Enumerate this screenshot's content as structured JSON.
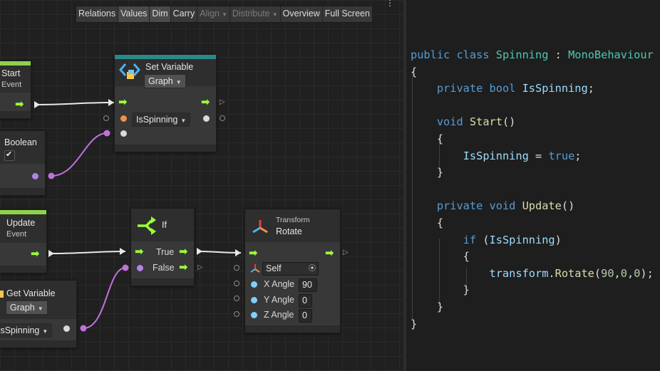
{
  "toolbar": {
    "buttons": [
      {
        "label": "Relations",
        "state": "normal"
      },
      {
        "label": "Values",
        "state": "active"
      },
      {
        "label": "Dim",
        "state": "active"
      },
      {
        "label": "Carry",
        "state": "normal"
      },
      {
        "label": "Align",
        "state": "disabled",
        "dropdown": true
      },
      {
        "label": "Distribute",
        "state": "disabled",
        "dropdown": true
      },
      {
        "label": "Overview",
        "state": "normal"
      },
      {
        "label": "Full Screen",
        "state": "normal"
      }
    ],
    "more_icon": "⋮"
  },
  "nodes": {
    "start_event": {
      "title": "Start",
      "subtitle": "Event",
      "accent": "#8fd14a"
    },
    "boolean": {
      "title": "Boolean",
      "checkbox": "✔"
    },
    "set_variable": {
      "title": "Set Variable",
      "kind": "Graph",
      "variable": "IsSpinning",
      "accent": "#2a8a8a"
    },
    "update_event": {
      "title": "Update",
      "subtitle": "Event",
      "accent": "#8fd14a"
    },
    "get_variable": {
      "title": "Get Variable",
      "kind": "Graph",
      "variable": "IsSpinning"
    },
    "if": {
      "title": "If",
      "true_label": "True",
      "false_label": "False"
    },
    "transform_rotate": {
      "category": "Transform",
      "title": "Rotate",
      "target": "Self",
      "fields": [
        {
          "label": "X Angle",
          "value": "90"
        },
        {
          "label": "Y Angle",
          "value": "0"
        },
        {
          "label": "Z Angle",
          "value": "0"
        }
      ]
    }
  },
  "code": {
    "lines": [
      [
        [
          "kw",
          "public "
        ],
        [
          "kw",
          "class "
        ],
        [
          "ty",
          "Spinning"
        ],
        [
          "p",
          " : "
        ],
        [
          "ty",
          "MonoBehaviour"
        ]
      ],
      [
        [
          "p",
          "{"
        ]
      ],
      [
        [
          "p",
          "    "
        ],
        [
          "kw",
          "private "
        ],
        [
          "kw",
          "bool "
        ],
        [
          "id",
          "IsSpinning"
        ],
        [
          "p",
          ";"
        ]
      ],
      [
        [
          "p",
          ""
        ]
      ],
      [
        [
          "p",
          "    "
        ],
        [
          "kw",
          "void "
        ],
        [
          "fn",
          "Start"
        ],
        [
          "p",
          "()"
        ]
      ],
      [
        [
          "p",
          "    {"
        ]
      ],
      [
        [
          "p",
          "        "
        ],
        [
          "id",
          "IsSpinning"
        ],
        [
          "p",
          " = "
        ],
        [
          "kw",
          "true"
        ],
        [
          "p",
          ";"
        ]
      ],
      [
        [
          "p",
          "    }"
        ]
      ],
      [
        [
          "p",
          ""
        ]
      ],
      [
        [
          "p",
          "    "
        ],
        [
          "kw",
          "private "
        ],
        [
          "kw",
          "void "
        ],
        [
          "fn",
          "Update"
        ],
        [
          "p",
          "()"
        ]
      ],
      [
        [
          "p",
          "    {"
        ]
      ],
      [
        [
          "p",
          "        "
        ],
        [
          "kw",
          "if "
        ],
        [
          "p",
          "("
        ],
        [
          "id",
          "IsSpinning"
        ],
        [
          "p",
          ")"
        ]
      ],
      [
        [
          "p",
          "        {"
        ]
      ],
      [
        [
          "p",
          "            "
        ],
        [
          "id",
          "transform"
        ],
        [
          "p",
          "."
        ],
        [
          "fn",
          "Rotate"
        ],
        [
          "p",
          "("
        ],
        [
          "nm",
          "90"
        ],
        [
          "p",
          ","
        ],
        [
          "nm",
          "0"
        ],
        [
          "p",
          ","
        ],
        [
          "nm",
          "0"
        ],
        [
          "p",
          ");"
        ]
      ],
      [
        [
          "p",
          "        }"
        ]
      ],
      [
        [
          "p",
          "    }"
        ]
      ],
      [
        [
          "p",
          "}"
        ]
      ]
    ]
  },
  "colors": {
    "flow_arrow": "#9cff3a",
    "bool_port": "#b084e6",
    "float_port": "#7fd0f5",
    "string_port": "#f0924a",
    "edge_bool": "#c171dc",
    "edge_flow": "#e8e8e8"
  }
}
